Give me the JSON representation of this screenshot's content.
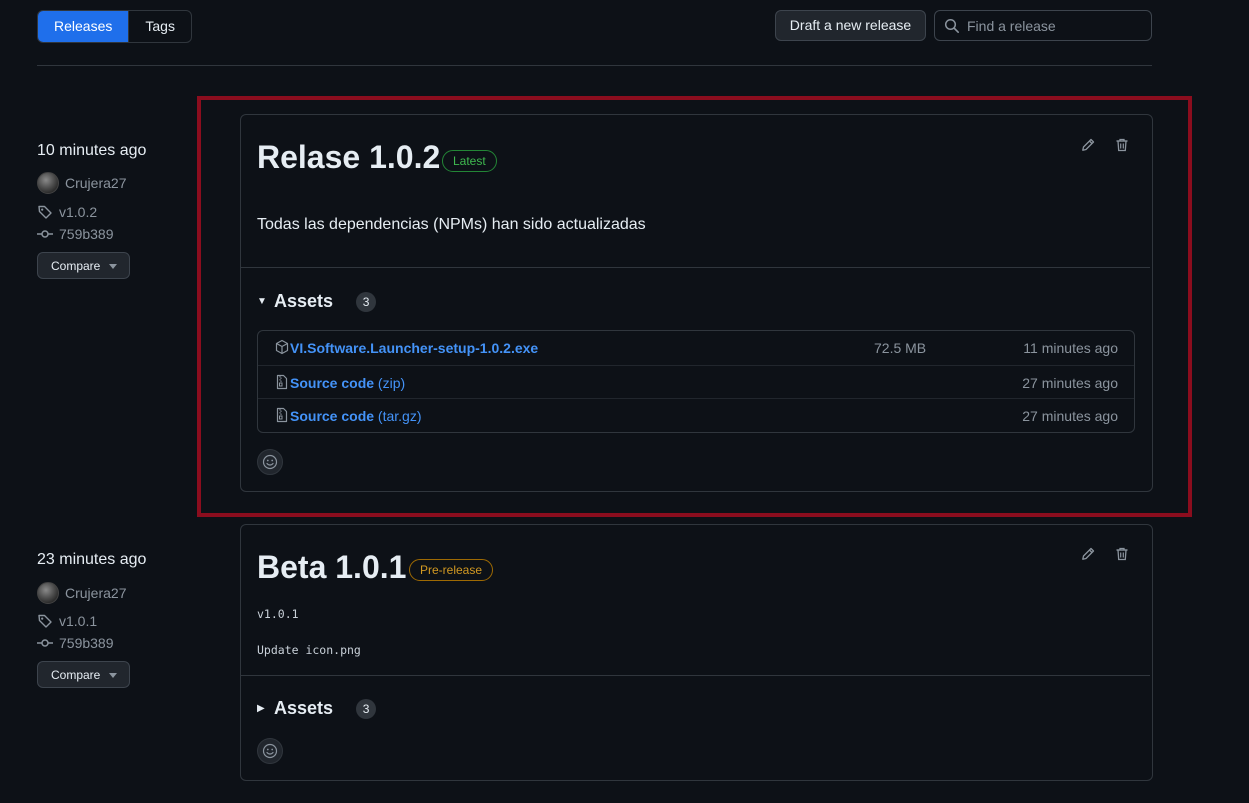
{
  "tabs": [
    {
      "label": "Releases",
      "active": true
    },
    {
      "label": "Tags",
      "active": false
    }
  ],
  "toolbar": {
    "draft_label": "Draft a new release",
    "search_placeholder": "Find a release"
  },
  "releases": [
    {
      "time": "10 minutes ago",
      "author": "Crujera27",
      "tag": "v1.0.2",
      "commit": "759b389",
      "compare_label": "Compare",
      "title": "Relase 1.0.2",
      "badge": "Latest",
      "badge_color": "#3fb950",
      "body": "Todas las dependencias (NPMs) han sido actualizadas",
      "assets_label": "Assets",
      "assets_count": "3",
      "assets_expanded": true,
      "assets": [
        {
          "icon": "package-icon",
          "name": "VI.Software.Launcher-setup-1.0.2.exe",
          "ext": "",
          "size": "72.5 MB",
          "time": "11 minutes ago"
        },
        {
          "icon": "file-zip-icon",
          "name": "Source code",
          "ext": " (zip)",
          "size": "",
          "time": "27 minutes ago"
        },
        {
          "icon": "file-zip-icon",
          "name": "Source code",
          "ext": " (tar.gz)",
          "size": "",
          "time": "27 minutes ago"
        }
      ]
    },
    {
      "time": "23 minutes ago",
      "author": "Crujera27",
      "tag": "v1.0.1",
      "commit": "759b389",
      "compare_label": "Compare",
      "title": "Beta 1.0.1",
      "badge": "Pre-release",
      "badge_color": "#d29922",
      "body_line1": "v1.0.1",
      "body_line2": "Update icon.png",
      "assets_label": "Assets",
      "assets_count": "3",
      "assets_expanded": false
    }
  ],
  "colors": {
    "background": "#0d1117",
    "accent": "#1f6feb",
    "link": "#4493f8",
    "highlight_frame": "#8b0d1e"
  }
}
